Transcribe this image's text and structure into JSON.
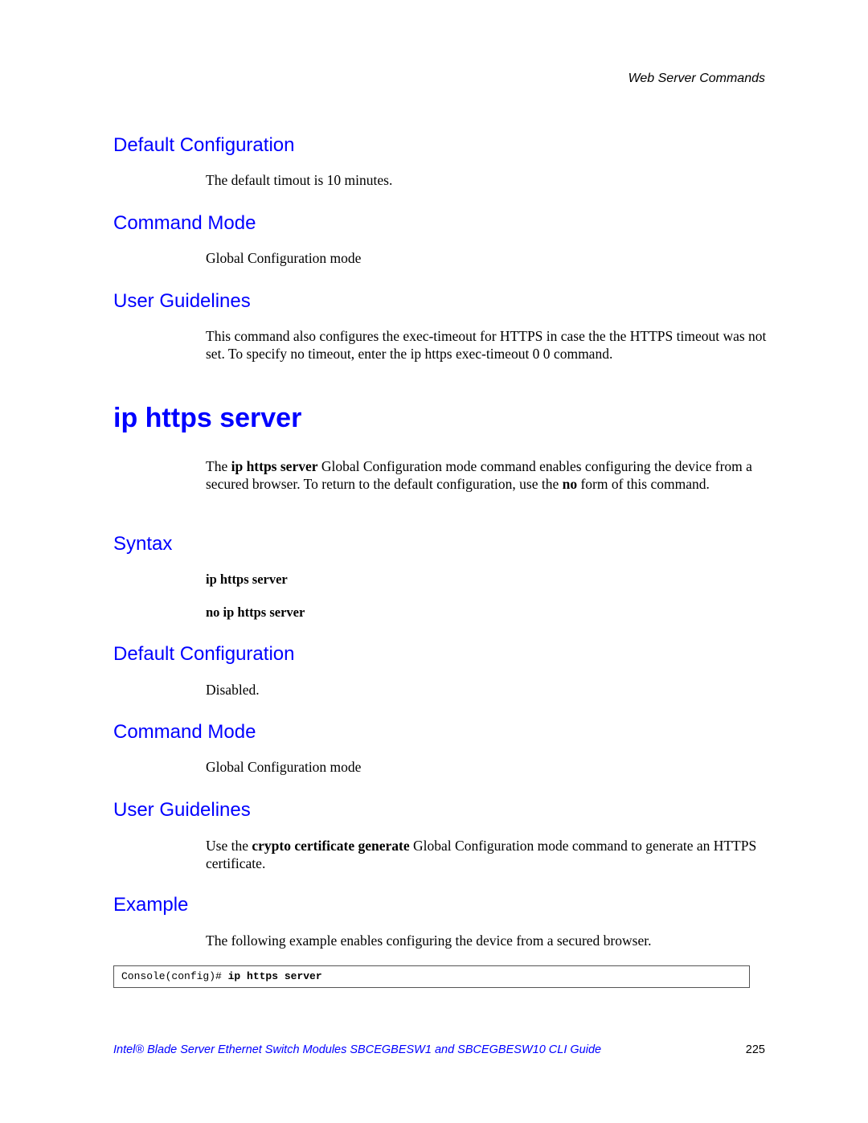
{
  "running_header": "Web Server Commands",
  "section_prev": {
    "default_config": {
      "heading": "Default Configuration",
      "text": "The default timout is 10 minutes."
    },
    "command_mode": {
      "heading": "Command Mode",
      "text": "Global Configuration mode"
    },
    "user_guidelines": {
      "heading": "User Guidelines",
      "text": "This command also configures the exec-timeout for HTTPS in case the the HTTPS timeout was not set. To specify no timeout, enter the ip https exec-timeout 0 0 command."
    }
  },
  "command": {
    "title": "ip https server",
    "description": {
      "part1": "The ",
      "bold1": "ip https server",
      "part2": " Global Configuration mode command enables configuring the device from a secured browser. To return to the default configuration, use the ",
      "bold2": "no",
      "part3": " form of this command."
    },
    "syntax": {
      "heading": "Syntax",
      "lines": [
        "ip https server",
        "no ip https server"
      ]
    },
    "default_config": {
      "heading": "Default Configuration",
      "text": "Disabled."
    },
    "command_mode": {
      "heading": "Command Mode",
      "text": "Global Configuration mode"
    },
    "user_guidelines": {
      "heading": "User Guidelines",
      "part1": "Use the ",
      "bold1": "crypto certificate generate",
      "part2": " Global Configuration mode command to generate an HTTPS certificate."
    },
    "example": {
      "heading": "Example",
      "text": "The following example enables configuring the device from a secured browser.",
      "code_prompt": "Console(config)# ",
      "code_command": "ip https server"
    }
  },
  "footer": {
    "title": "Intel® Blade Server Ethernet Switch Modules SBCEGBESW1 and SBCEGBESW10 CLI Guide",
    "page_number": "225"
  },
  "colors": {
    "heading_blue": "#0000ff",
    "text": "#000000"
  }
}
